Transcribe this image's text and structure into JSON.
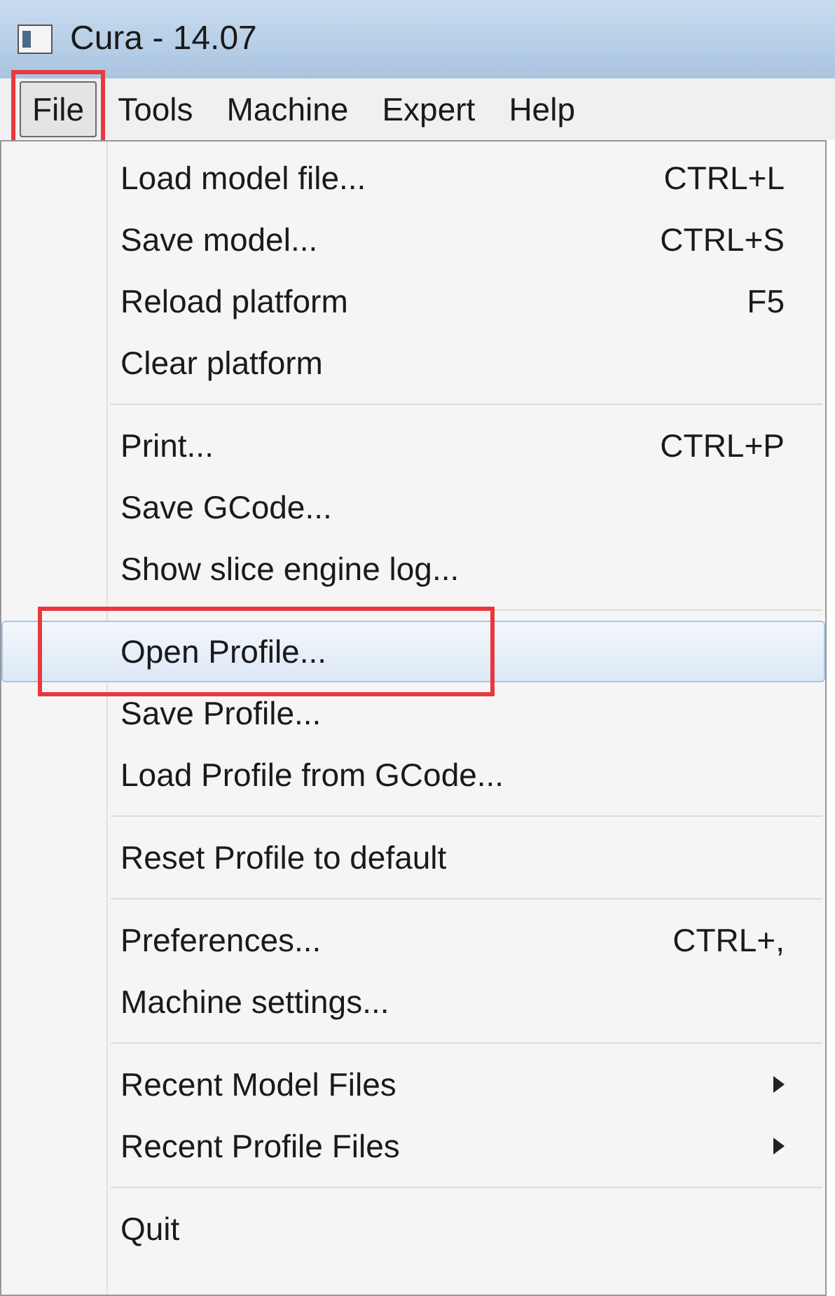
{
  "window": {
    "title": "Cura - 14.07"
  },
  "menubar": [
    {
      "label": "File",
      "selected": true,
      "annotated": true
    },
    {
      "label": "Tools",
      "selected": false,
      "annotated": false
    },
    {
      "label": "Machine",
      "selected": false,
      "annotated": false
    },
    {
      "label": "Expert",
      "selected": false,
      "annotated": false
    },
    {
      "label": "Help",
      "selected": false,
      "annotated": false
    }
  ],
  "menu": {
    "sections": [
      [
        {
          "label": "Load model file...",
          "shortcut": "CTRL+L",
          "submenu": false,
          "selected": false,
          "annotated": false
        },
        {
          "label": "Save model...",
          "shortcut": "CTRL+S",
          "submenu": false,
          "selected": false,
          "annotated": false
        },
        {
          "label": "Reload platform",
          "shortcut": "F5",
          "submenu": false,
          "selected": false,
          "annotated": false
        },
        {
          "label": "Clear platform",
          "submenu": false,
          "selected": false,
          "annotated": false
        }
      ],
      [
        {
          "label": "Print...",
          "shortcut": "CTRL+P",
          "submenu": false,
          "selected": false,
          "annotated": false
        },
        {
          "label": "Save GCode...",
          "submenu": false,
          "selected": false,
          "annotated": false
        },
        {
          "label": "Show slice engine log...",
          "submenu": false,
          "selected": false,
          "annotated": false
        }
      ],
      [
        {
          "label": "Open Profile...",
          "submenu": false,
          "selected": true,
          "annotated": true
        },
        {
          "label": "Save Profile...",
          "submenu": false,
          "selected": false,
          "annotated": false
        },
        {
          "label": "Load Profile from GCode...",
          "submenu": false,
          "selected": false,
          "annotated": false
        }
      ],
      [
        {
          "label": "Reset Profile to default",
          "submenu": false,
          "selected": false,
          "annotated": false
        }
      ],
      [
        {
          "label": "Preferences...",
          "shortcut": "CTRL+,",
          "submenu": false,
          "selected": false,
          "annotated": false
        },
        {
          "label": "Machine settings...",
          "submenu": false,
          "selected": false,
          "annotated": false
        }
      ],
      [
        {
          "label": "Recent Model Files",
          "submenu": true,
          "selected": false,
          "annotated": false
        },
        {
          "label": "Recent Profile Files",
          "submenu": true,
          "selected": false,
          "annotated": false
        }
      ],
      [
        {
          "label": "Quit",
          "submenu": false,
          "selected": false,
          "annotated": false
        }
      ]
    ]
  }
}
